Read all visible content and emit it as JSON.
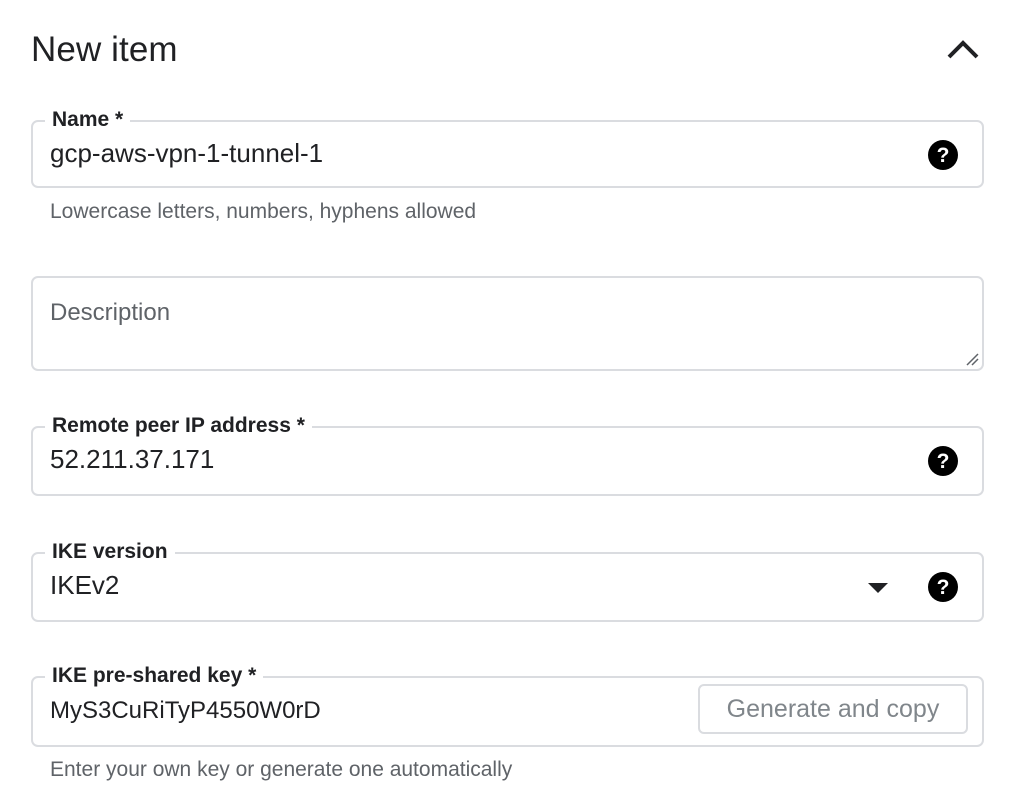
{
  "header": {
    "title": "New item"
  },
  "name_field": {
    "label": "Name *",
    "value": "gcp-aws-vpn-1-tunnel-1",
    "hint": "Lowercase letters, numbers, hyphens allowed"
  },
  "description_field": {
    "placeholder": "Description"
  },
  "remote_ip_field": {
    "label": "Remote peer IP address *",
    "value": "52.211.37.171"
  },
  "ike_version_field": {
    "label": "IKE version",
    "value": "IKEv2"
  },
  "psk_field": {
    "label": "IKE pre-shared key *",
    "value": "MyS3CuRiTyP4550W0rD",
    "generate_button": "Generate and copy",
    "hint": "Enter your own key or generate one automatically"
  },
  "icons": {
    "help": "help-circle-icon",
    "collapse": "chevron-up-icon",
    "dropdown": "dropdown-arrow-icon"
  },
  "colors": {
    "border": "#dadce0",
    "text": "#202124",
    "hint_text": "#5f6368",
    "disabled_text": "#80868b"
  }
}
